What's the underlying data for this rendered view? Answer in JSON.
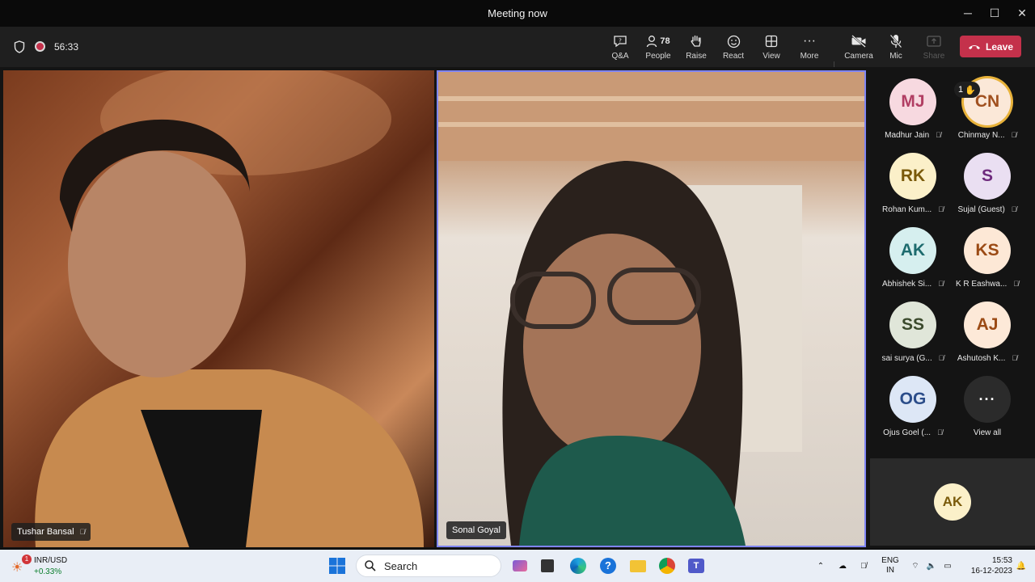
{
  "window": {
    "title": "Meeting now"
  },
  "toolbar": {
    "timer": "56:33",
    "qa_label": "Q&A",
    "people_label": "People",
    "people_count": "78",
    "raise_label": "Raise",
    "react_label": "React",
    "view_label": "View",
    "more_label": "More",
    "camera_label": "Camera",
    "mic_label": "Mic",
    "share_label": "Share",
    "leave_label": "Leave"
  },
  "stage": {
    "tiles": [
      {
        "name": "Tushar Bansal"
      },
      {
        "name": "Sonal Goyal"
      }
    ]
  },
  "participants": [
    {
      "initials": "MJ",
      "name": "Madhur Jain",
      "bg": "#f7d9e0",
      "fg": "#b13e63"
    },
    {
      "initials": "CN",
      "name": "Chinmay N...",
      "bg": "#fbe8d8",
      "fg": "#a0501f",
      "hand": "1"
    },
    {
      "initials": "RK",
      "name": "Rohan Kum...",
      "bg": "#fbf0c9",
      "fg": "#7a5a0a"
    },
    {
      "initials": "S",
      "name": "Sujal (Guest)",
      "bg": "#eadff2",
      "fg": "#6e2b7d"
    },
    {
      "initials": "AK",
      "name": "Abhishek Si...",
      "bg": "#d6efef",
      "fg": "#1d6b6e"
    },
    {
      "initials": "KS",
      "name": "K R Eashwa...",
      "bg": "#fde8d6",
      "fg": "#9b4a14"
    },
    {
      "initials": "SS",
      "name": "sai surya (G...",
      "bg": "#e0e6d9",
      "fg": "#3b4a2d"
    },
    {
      "initials": "AJ",
      "name": "Ashutosh K...",
      "bg": "#fde9d8",
      "fg": "#9b4a14"
    },
    {
      "initials": "OG",
      "name": "Ojus Goel (...",
      "bg": "#dde7f6",
      "fg": "#2b4d8a"
    }
  ],
  "view_all_label": "View all",
  "self_initials": "AK",
  "taskbar": {
    "ticker_name": "INR/USD",
    "ticker_change": "+0.33%",
    "ticker_badge": "1",
    "search_label": "Search",
    "lang_1": "ENG",
    "lang_2": "IN",
    "time": "15:53",
    "date": "16-12-2023"
  },
  "colors": {
    "leave": "#c4314b",
    "active_speaker_border": "#7f85f5",
    "hand_ring": "#e8b23a"
  }
}
